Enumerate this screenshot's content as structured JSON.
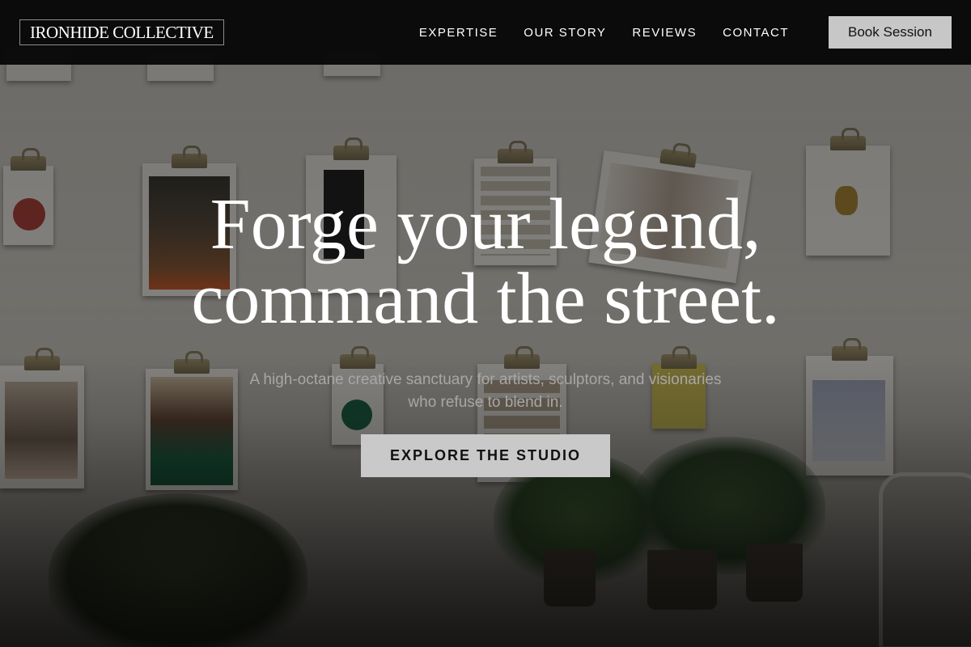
{
  "brand": {
    "logo_text": "IRONHIDE COLLECTIVE"
  },
  "nav": {
    "items": [
      {
        "label": "EXPERTISE"
      },
      {
        "label": "OUR STORY"
      },
      {
        "label": "REVIEWS"
      },
      {
        "label": "CONTACT"
      }
    ],
    "cta_label": "Book Session"
  },
  "hero": {
    "headline_line1": "Forge your legend,",
    "headline_line2": "command the street.",
    "subtitle_line1": "A high-octane creative sanctuary for artists, sculptors, and visionaries",
    "subtitle_line2": "who refuse to blend in.",
    "cta_label": "EXPLORE THE STUDIO",
    "background_description_icon": "wall-of-clipboards-photo"
  },
  "colors": {
    "header_bg": "#080808",
    "button_bg": "#c7c7c7",
    "headline_text": "#ffffff",
    "subtitle_text": "#a7a7a7"
  }
}
